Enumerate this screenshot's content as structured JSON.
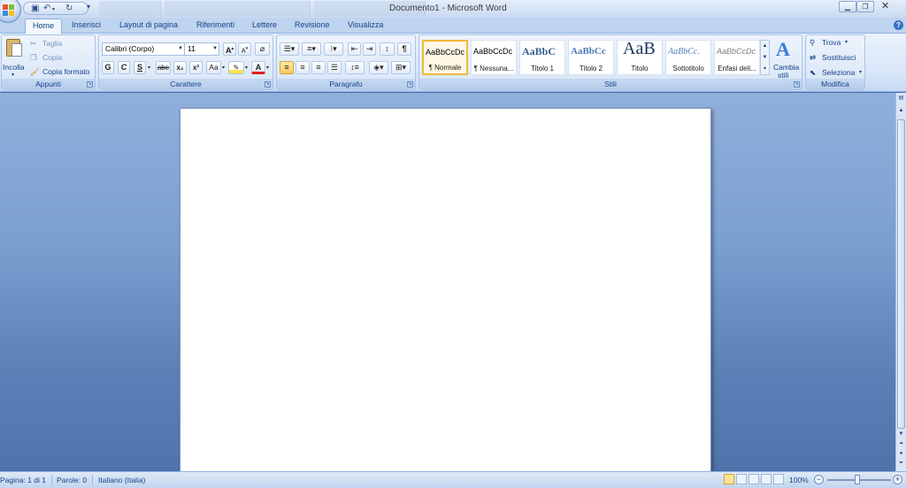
{
  "window": {
    "title": "Documento1 - Microsoft Word"
  },
  "tabs": [
    "Home",
    "Inserisci",
    "Layout di pagina",
    "Riferimenti",
    "Lettere",
    "Revisione",
    "Visualizza"
  ],
  "clipboard": {
    "paste_label": "Incolla",
    "cut_label": "Taglia",
    "copy_label": "Copia",
    "format_painter_label": "Copia formato",
    "caption": "Appunti"
  },
  "font": {
    "name": "Calibri (Corpo)",
    "size": "11",
    "caption": "Carattere",
    "bold": "G",
    "italic": "C",
    "underline": "S",
    "strike": "abe",
    "subscript": "x₂",
    "superscript": "x²",
    "change_case": "Aa"
  },
  "paragraph": {
    "caption": "Paragrafo"
  },
  "styles": {
    "caption": "Stili",
    "items": [
      {
        "sample": "AaBbCcDc",
        "name": "¶ Normale"
      },
      {
        "sample": "AaBbCcDc",
        "name": "¶ Nessuna..."
      },
      {
        "sample": "AaBbC",
        "name": "Titolo 1"
      },
      {
        "sample": "AaBbCc",
        "name": "Titolo 2"
      },
      {
        "sample": "AaB",
        "name": "Titolo"
      },
      {
        "sample": "AaBbCc.",
        "name": "Sottotitolo"
      },
      {
        "sample": "AaBbCcDc",
        "name": "Enfasi deli..."
      }
    ],
    "change_styles_line1": "Cambia",
    "change_styles_line2": "stili"
  },
  "editing": {
    "caption": "Modifica",
    "find": "Trova",
    "replace": "Sostituisci",
    "select": "Seleziona"
  },
  "status": {
    "page": "Pagina: 1 di 1",
    "words": "Parole: 0",
    "language": "Italiano (Italia)",
    "zoom": "100%"
  },
  "colors": {
    "accent": "#15428b",
    "ribbon": "#dbe7f7",
    "workspace": "#6b8fc4"
  }
}
